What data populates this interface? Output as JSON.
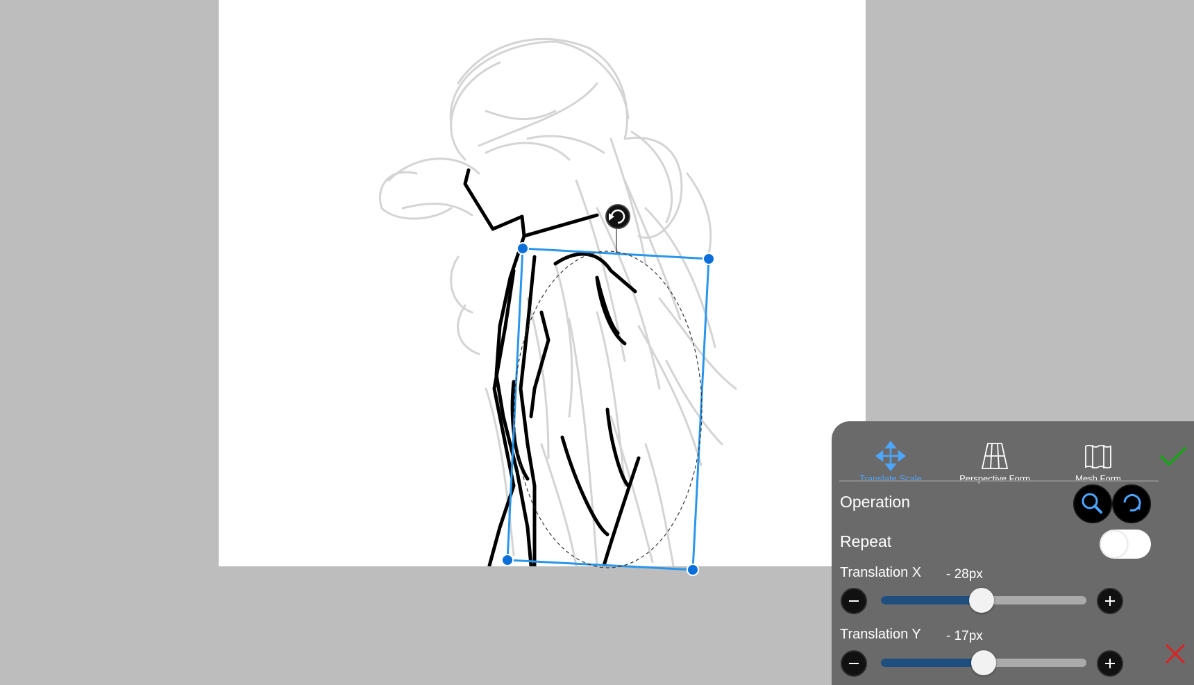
{
  "tabs": [
    {
      "label": "Translate Scale",
      "icon": "move-arrows-icon",
      "active": true
    },
    {
      "label": "Perspective Form",
      "icon": "perspective-grid-icon",
      "active": false
    },
    {
      "label": "Mesh Form",
      "icon": "mesh-map-icon",
      "active": false
    }
  ],
  "operation": {
    "label": "Operation",
    "zoom_icon": "zoom-icon",
    "rotate_icon": "rotate-icon"
  },
  "repeat": {
    "label": "Repeat",
    "enabled": false
  },
  "translation_x": {
    "label": "Translation X",
    "value": "- 28px",
    "slider_fraction": 0.49
  },
  "translation_y": {
    "label": "Translation Y",
    "value": "- 17px",
    "slider_fraction": 0.5
  },
  "colors": {
    "accent": "#4da6ff",
    "handle": "#0a6fd8",
    "confirm": "#1fa01f",
    "cancel": "#e02020",
    "panel": "#6a6a6a"
  }
}
